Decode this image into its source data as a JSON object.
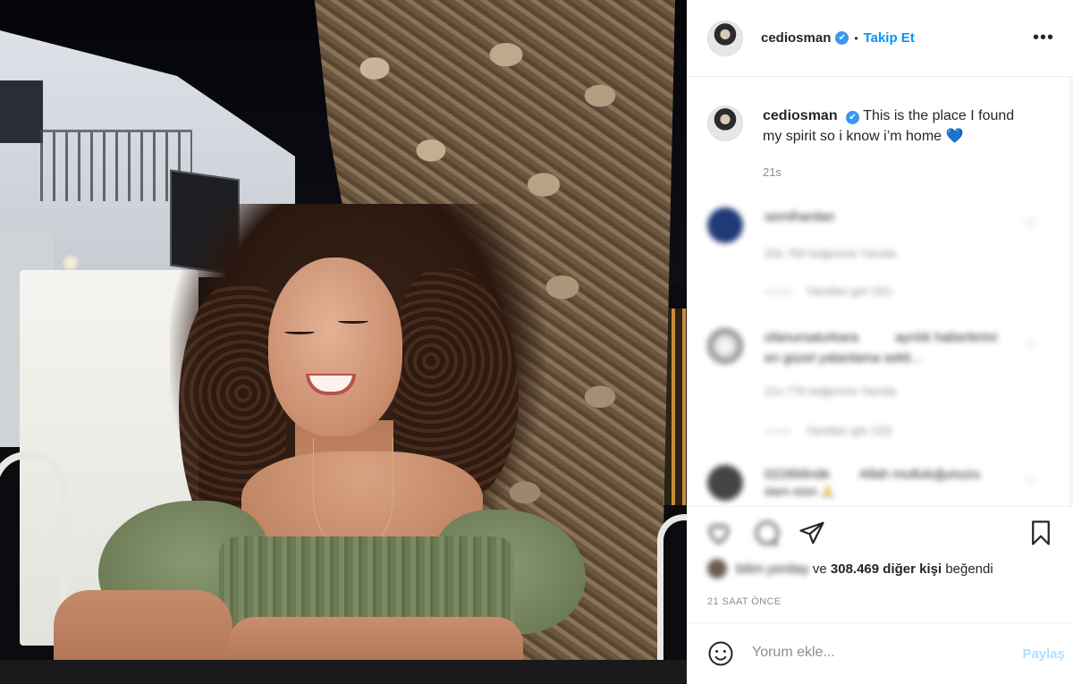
{
  "post": {
    "username": "cediosman",
    "verified_mark": "✔",
    "separator": "•",
    "follow_label": "Takip Et",
    "more_label": "•••",
    "caption_line1": "This is the place I found",
    "caption_line2": "my spirit so i know i’m home",
    "caption_emoji": "💙",
    "caption_time": "21s"
  },
  "comments": [
    {
      "name": "semihardan",
      "meta": "20s   760 beğenme   Yanıtla",
      "replies": "Yanıtları gör (31)"
    },
    {
      "name": "ofanursaturkara",
      "text_line1": "ayrılık haberlerini",
      "text_line2": "en güzel yalanlama sekli...",
      "meta": "21s   776 beğenme   Yanıtla",
      "replies": "Yanıtları gör (10)"
    },
    {
      "name": "0226blinde",
      "text_line1": "Allah mutluluğunuzu",
      "text_line2": "daim etsin 🙏"
    }
  ],
  "likes": {
    "liker": "bilim.yenilay",
    "connector": "ve",
    "count": "308.469 diğer kişi",
    "suffix": "beğendi"
  },
  "time_ago": "21 SAAT ÖNCE",
  "comment_input": {
    "placeholder": "Yorum ekle...",
    "share_label": "Paylaş"
  },
  "icons": {
    "avatar": "profile-avatar",
    "like": "heart-outline-icon",
    "comment": "comment-bubble-icon",
    "share": "paper-plane-icon",
    "save": "bookmark-icon",
    "emoji": "smiley-icon"
  },
  "colors": {
    "follow": "#0095f6",
    "verified": "#3897f0",
    "muted": "#8e8e8e",
    "share_disabled": "#b2dffc"
  }
}
